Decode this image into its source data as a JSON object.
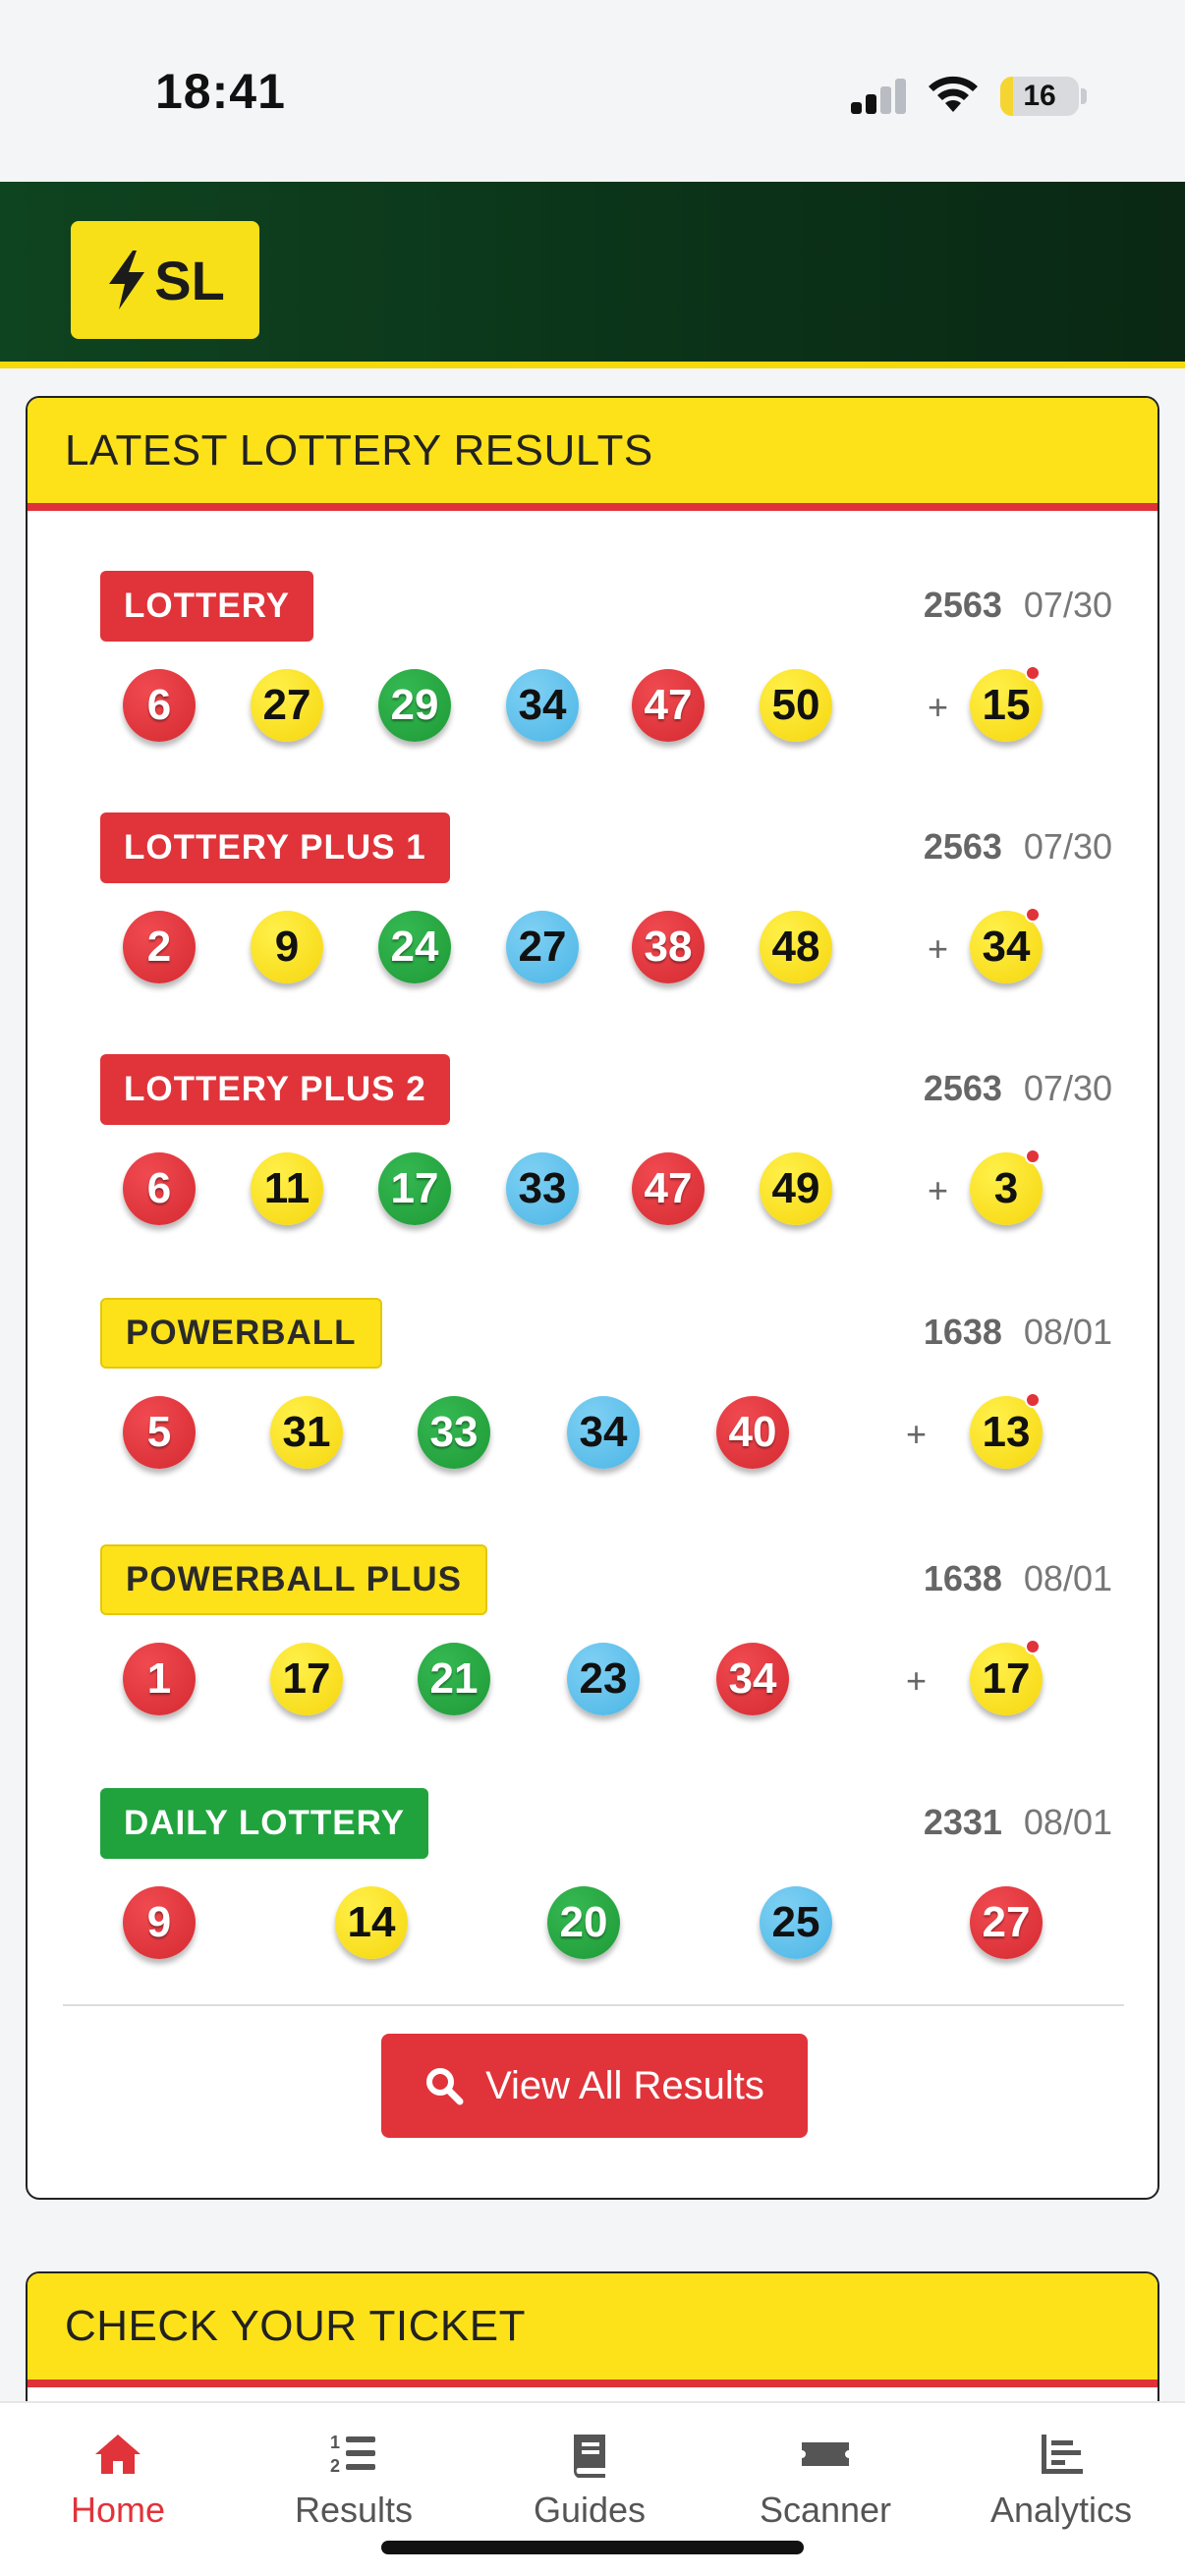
{
  "status_bar": {
    "time": "18:41",
    "battery": "16",
    "battery_level": 0.16
  },
  "header": {
    "logo_text": "SL"
  },
  "latest_results": {
    "title": "LATEST LOTTERY RESULTS",
    "games": [
      {
        "name": "LOTTERY",
        "badge_color": "red",
        "draw": "2563",
        "date": "07/30",
        "balls": [
          {
            "n": "6",
            "c": "red"
          },
          {
            "n": "27",
            "c": "yellow"
          },
          {
            "n": "29",
            "c": "green"
          },
          {
            "n": "34",
            "c": "blue"
          },
          {
            "n": "47",
            "c": "red"
          },
          {
            "n": "50",
            "c": "yellow"
          }
        ],
        "bonus": {
          "n": "15",
          "c": "yellow"
        }
      },
      {
        "name": "LOTTERY PLUS 1",
        "badge_color": "red",
        "draw": "2563",
        "date": "07/30",
        "balls": [
          {
            "n": "2",
            "c": "red"
          },
          {
            "n": "9",
            "c": "yellow"
          },
          {
            "n": "24",
            "c": "green"
          },
          {
            "n": "27",
            "c": "blue"
          },
          {
            "n": "38",
            "c": "red"
          },
          {
            "n": "48",
            "c": "yellow"
          }
        ],
        "bonus": {
          "n": "34",
          "c": "yellow"
        }
      },
      {
        "name": "LOTTERY PLUS 2",
        "badge_color": "red",
        "draw": "2563",
        "date": "07/30",
        "balls": [
          {
            "n": "6",
            "c": "red"
          },
          {
            "n": "11",
            "c": "yellow"
          },
          {
            "n": "17",
            "c": "green"
          },
          {
            "n": "33",
            "c": "blue"
          },
          {
            "n": "47",
            "c": "red"
          },
          {
            "n": "49",
            "c": "yellow"
          }
        ],
        "bonus": {
          "n": "3",
          "c": "yellow"
        }
      },
      {
        "name": "POWERBALL",
        "badge_color": "yellow",
        "draw": "1638",
        "date": "08/01",
        "balls": [
          {
            "n": "5",
            "c": "red"
          },
          {
            "n": "31",
            "c": "yellow"
          },
          {
            "n": "33",
            "c": "green"
          },
          {
            "n": "34",
            "c": "blue"
          },
          {
            "n": "40",
            "c": "red"
          }
        ],
        "bonus": {
          "n": "13",
          "c": "yellow"
        }
      },
      {
        "name": "POWERBALL PLUS",
        "badge_color": "yellow",
        "draw": "1638",
        "date": "08/01",
        "balls": [
          {
            "n": "1",
            "c": "red"
          },
          {
            "n": "17",
            "c": "yellow"
          },
          {
            "n": "21",
            "c": "green"
          },
          {
            "n": "23",
            "c": "blue"
          },
          {
            "n": "34",
            "c": "red"
          }
        ],
        "bonus": {
          "n": "17",
          "c": "yellow"
        }
      },
      {
        "name": "DAILY LOTTERY",
        "badge_color": "green",
        "draw": "2331",
        "date": "08/01",
        "balls": [
          {
            "n": "9",
            "c": "red"
          },
          {
            "n": "14",
            "c": "yellow"
          },
          {
            "n": "20",
            "c": "green"
          },
          {
            "n": "25",
            "c": "blue"
          },
          {
            "n": "27",
            "c": "red"
          }
        ],
        "bonus": null
      }
    ],
    "plus_sign": "+",
    "view_all_label": "View All Results"
  },
  "check_ticket": {
    "title": "CHECK YOUR TICKET"
  },
  "tabbar": {
    "tabs": [
      {
        "label": "Home",
        "icon": "home-icon",
        "active": true
      },
      {
        "label": "Results",
        "icon": "list-ordered-icon",
        "active": false
      },
      {
        "label": "Guides",
        "icon": "book-icon",
        "active": false
      },
      {
        "label": "Scanner",
        "icon": "ticket-icon",
        "active": false
      },
      {
        "label": "Analytics",
        "icon": "chart-icon",
        "active": false
      }
    ]
  },
  "colors": {
    "accent_red": "#e1333a",
    "accent_yellow": "#fde21a",
    "brand_green": "#0f4420"
  }
}
